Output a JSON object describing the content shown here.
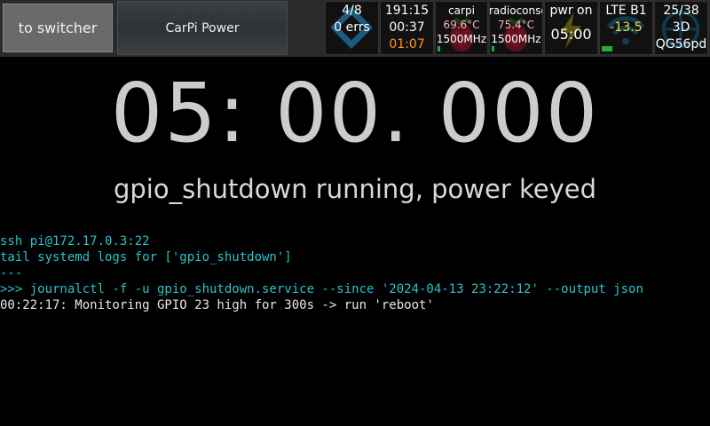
{
  "topbar": {
    "switcher_label": "to switcher",
    "title": "CarPi Power"
  },
  "tiles": {
    "gps_sats": {
      "line1": "4/8",
      "line2": "0 errs",
      "icon": "diamond-icon"
    },
    "time": {
      "line1": "191:15",
      "line2": "00:37",
      "line3": "01:07",
      "line3_color": "#ff9a1a"
    },
    "host1": {
      "name": "carpi",
      "temp": "69.6°C",
      "freq": "1500MHz",
      "icon": "raspberry-icon"
    },
    "host2": {
      "name": "radioconsole",
      "temp": "75.4°C",
      "freq": "1500MHz",
      "icon": "raspberry-icon"
    },
    "power": {
      "line1": "pwr on",
      "line2": "05:00",
      "icon": "lightning-icon"
    },
    "lte": {
      "line1": "LTE B1",
      "line2": "-13.5",
      "line2_color": "#e6e04a",
      "icon": "wifi-signal-icon"
    },
    "gps_fix": {
      "line1": "25/38",
      "line2": "3D",
      "line3": "QG56pd",
      "icon": "globe-icon"
    }
  },
  "main": {
    "timer": "05: 00. 000",
    "status": "gpio_shutdown running, power keyed"
  },
  "log": [
    {
      "text": "ssh pi@172.17.0.3:22",
      "color": "cyan"
    },
    {
      "text": "tail systemd logs for ['gpio_shutdown']",
      "color": "cyan"
    },
    {
      "text": "---",
      "color": "cyan"
    },
    {
      "text": ">>> journalctl -f -u gpio_shutdown.service --since '2024-04-13 23:22:12' --output json",
      "color": "cyan"
    },
    {
      "text": "00:22:17: Monitoring GPIO 23 high for 300s -> run 'reboot'",
      "color": "white"
    }
  ],
  "colors": {
    "background": "#000000",
    "log_cyan": "#2bc3c9",
    "status_green": "#1db33a"
  }
}
